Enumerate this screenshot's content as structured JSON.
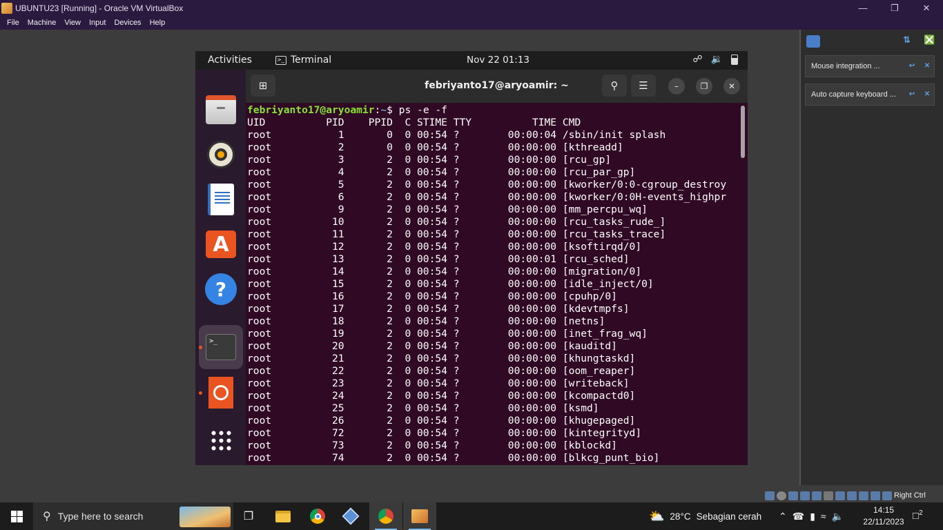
{
  "vbox": {
    "title": "UBUNTU23 [Running] - Oracle VM VirtualBox",
    "menu": [
      "File",
      "Machine",
      "View",
      "Input",
      "Devices",
      "Help"
    ],
    "panel_notices": [
      "Mouse integration ...",
      "Auto capture keyboard ..."
    ],
    "host_key": "Right Ctrl"
  },
  "gnome": {
    "activities": "Activities",
    "app_name": "Terminal",
    "clock": "Nov 22  01:13"
  },
  "terminal": {
    "title": "febriyanto17@aryoamir: ~",
    "prompt_user": "febriyanto17@aryoamir",
    "prompt_sep": ":",
    "prompt_path": "~",
    "prompt_end": "$ ps -e -f",
    "header": "UID          PID    PPID  C STIME TTY          TIME CMD",
    "rows": [
      "root           1       0  0 00:54 ?        00:00:04 /sbin/init splash",
      "root           2       0  0 00:54 ?        00:00:00 [kthreadd]",
      "root           3       2  0 00:54 ?        00:00:00 [rcu_gp]",
      "root           4       2  0 00:54 ?        00:00:00 [rcu_par_gp]",
      "root           5       2  0 00:54 ?        00:00:00 [kworker/0:0-cgroup_destroy",
      "root           6       2  0 00:54 ?        00:00:00 [kworker/0:0H-events_highpr",
      "root           9       2  0 00:54 ?        00:00:00 [mm_percpu_wq]",
      "root          10       2  0 00:54 ?        00:00:00 [rcu_tasks_rude_]",
      "root          11       2  0 00:54 ?        00:00:00 [rcu_tasks_trace]",
      "root          12       2  0 00:54 ?        00:00:00 [ksoftirqd/0]",
      "root          13       2  0 00:54 ?        00:00:01 [rcu_sched]",
      "root          14       2  0 00:54 ?        00:00:00 [migration/0]",
      "root          15       2  0 00:54 ?        00:00:00 [idle_inject/0]",
      "root          16       2  0 00:54 ?        00:00:00 [cpuhp/0]",
      "root          17       2  0 00:54 ?        00:00:00 [kdevtmpfs]",
      "root          18       2  0 00:54 ?        00:00:00 [netns]",
      "root          19       2  0 00:54 ?        00:00:00 [inet_frag_wq]",
      "root          20       2  0 00:54 ?        00:00:00 [kauditd]",
      "root          21       2  0 00:54 ?        00:00:00 [khungtaskd]",
      "root          22       2  0 00:54 ?        00:00:00 [oom_reaper]",
      "root          23       2  0 00:54 ?        00:00:00 [writeback]",
      "root          24       2  0 00:54 ?        00:00:00 [kcompactd0]",
      "root          25       2  0 00:54 ?        00:00:00 [ksmd]",
      "root          26       2  0 00:54 ?        00:00:00 [khugepaged]",
      "root          72       2  0 00:54 ?        00:00:00 [kintegrityd]",
      "root          73       2  0 00:54 ?        00:00:00 [kblockd]",
      "root          74       2  0 00:54 ?        00:00:00 [blkcg_punt_bio]"
    ]
  },
  "dock": {
    "items": [
      "files-icon",
      "rhythmbox-icon",
      "writer-icon",
      "app-center-icon",
      "help-icon",
      "terminal-icon",
      "ubuntu-icon",
      "show-apps-icon"
    ],
    "active_color": "#e95420"
  },
  "taskbar": {
    "search_placeholder": "Type here to search",
    "weather_temp": "28°C",
    "weather_desc": "Sebagian cerah",
    "time": "14:15",
    "date": "22/11/2023",
    "notifications": "2"
  }
}
